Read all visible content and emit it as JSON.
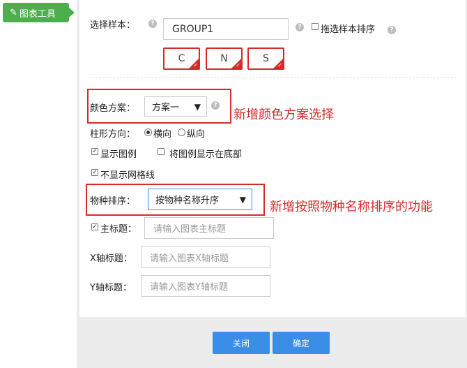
{
  "sidebar": {
    "tab_icon": "wand-icon",
    "tab_label": "图表工具"
  },
  "form": {
    "select_sample": {
      "label": "选择样本：",
      "value": "GROUP1",
      "drag_sort_label": "拖选样本排序",
      "samples": [
        "C",
        "N",
        "S"
      ]
    },
    "color_scheme": {
      "label": "颜色方案：",
      "value": "方案一"
    },
    "bar_direction": {
      "label": "柱形方向：",
      "options": [
        {
          "label": "横向",
          "selected": true
        },
        {
          "label": "纵向",
          "selected": false
        }
      ]
    },
    "show_legend": {
      "label": "显示图例",
      "checked": true
    },
    "legend_bottom": {
      "label": "将图例显示在底部",
      "checked": false
    },
    "hide_grid": {
      "label": "不显示网格线",
      "checked": true
    },
    "species_sort": {
      "label": "物种排序：",
      "value": "按物种名称升序"
    },
    "main_title": {
      "label": "主标题：",
      "checked": true,
      "placeholder": "请输入图表主标题"
    },
    "x_title": {
      "label": "X轴标题：",
      "placeholder": "请输入图表X轴标题"
    },
    "y_title": {
      "label": "Y轴标题：",
      "placeholder": "请输入图表Y轴标题"
    }
  },
  "annotations": {
    "color_scheme_note": "新增颜色方案选择",
    "species_sort_note": "新增按照物种名称排序的功能"
  },
  "footer": {
    "close_label": "关闭",
    "confirm_label": "确定"
  },
  "colors": {
    "tab_green": "#4cae4c",
    "highlight_red": "#d62b2b",
    "button_blue": "#3a8ee6"
  }
}
